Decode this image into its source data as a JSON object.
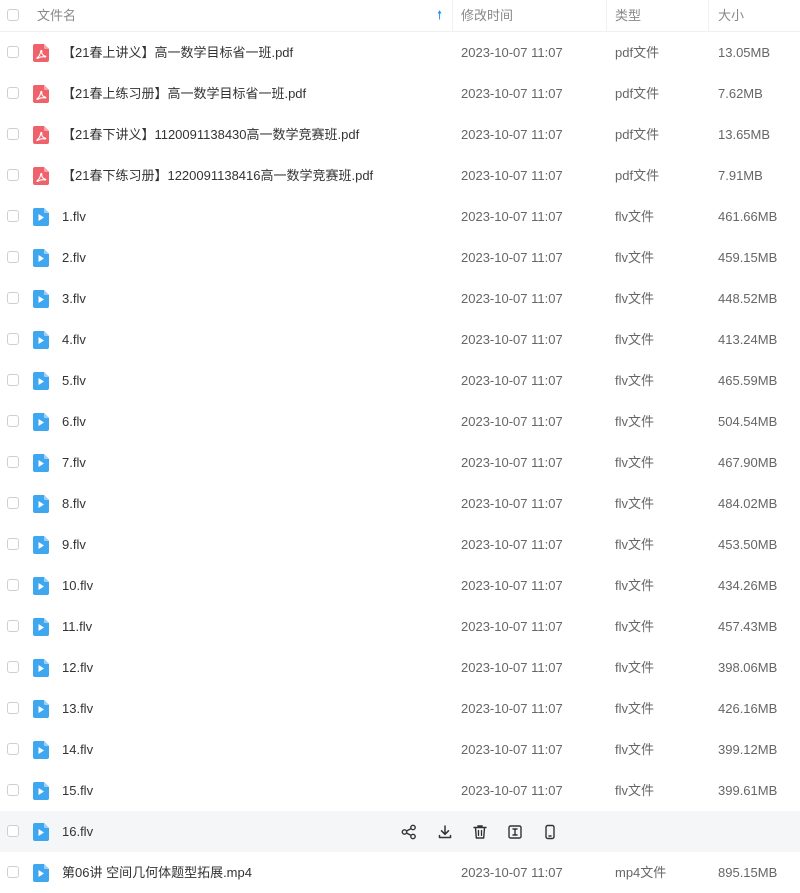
{
  "header": {
    "name_label": "文件名",
    "mtime_label": "修改时间",
    "type_label": "类型",
    "size_label": "大小",
    "sort_icon": "sort-ascending-arrow-icon"
  },
  "colors": {
    "accent": "#1e90ff",
    "pdf_icon": "#f0626b",
    "video_icon": "#3fa6f0",
    "hover_row": "#f5f6f8"
  },
  "files": [
    {
      "name": "【21春上讲义】高一数学目标省一班.pdf",
      "mtime": "2023-10-07 11:07",
      "type": "pdf文件",
      "size": "13.05MB",
      "icon": "pdf-file-icon"
    },
    {
      "name": "【21春上练习册】高一数学目标省一班.pdf",
      "mtime": "2023-10-07 11:07",
      "type": "pdf文件",
      "size": "7.62MB",
      "icon": "pdf-file-icon"
    },
    {
      "name": "【21春下讲义】1120091138430高一数学竞赛班.pdf",
      "mtime": "2023-10-07 11:07",
      "type": "pdf文件",
      "size": "13.65MB",
      "icon": "pdf-file-icon"
    },
    {
      "name": "【21春下练习册】1220091138416高一数学竞赛班.pdf",
      "mtime": "2023-10-07 11:07",
      "type": "pdf文件",
      "size": "7.91MB",
      "icon": "pdf-file-icon"
    },
    {
      "name": "1.flv",
      "mtime": "2023-10-07 11:07",
      "type": "flv文件",
      "size": "461.66MB",
      "icon": "video-file-icon"
    },
    {
      "name": "2.flv",
      "mtime": "2023-10-07 11:07",
      "type": "flv文件",
      "size": "459.15MB",
      "icon": "video-file-icon"
    },
    {
      "name": "3.flv",
      "mtime": "2023-10-07 11:07",
      "type": "flv文件",
      "size": "448.52MB",
      "icon": "video-file-icon"
    },
    {
      "name": "4.flv",
      "mtime": "2023-10-07 11:07",
      "type": "flv文件",
      "size": "413.24MB",
      "icon": "video-file-icon"
    },
    {
      "name": "5.flv",
      "mtime": "2023-10-07 11:07",
      "type": "flv文件",
      "size": "465.59MB",
      "icon": "video-file-icon"
    },
    {
      "name": "6.flv",
      "mtime": "2023-10-07 11:07",
      "type": "flv文件",
      "size": "504.54MB",
      "icon": "video-file-icon"
    },
    {
      "name": "7.flv",
      "mtime": "2023-10-07 11:07",
      "type": "flv文件",
      "size": "467.90MB",
      "icon": "video-file-icon"
    },
    {
      "name": "8.flv",
      "mtime": "2023-10-07 11:07",
      "type": "flv文件",
      "size": "484.02MB",
      "icon": "video-file-icon"
    },
    {
      "name": "9.flv",
      "mtime": "2023-10-07 11:07",
      "type": "flv文件",
      "size": "453.50MB",
      "icon": "video-file-icon"
    },
    {
      "name": "10.flv",
      "mtime": "2023-10-07 11:07",
      "type": "flv文件",
      "size": "434.26MB",
      "icon": "video-file-icon"
    },
    {
      "name": "11.flv",
      "mtime": "2023-10-07 11:07",
      "type": "flv文件",
      "size": "457.43MB",
      "icon": "video-file-icon"
    },
    {
      "name": "12.flv",
      "mtime": "2023-10-07 11:07",
      "type": "flv文件",
      "size": "398.06MB",
      "icon": "video-file-icon"
    },
    {
      "name": "13.flv",
      "mtime": "2023-10-07 11:07",
      "type": "flv文件",
      "size": "426.16MB",
      "icon": "video-file-icon"
    },
    {
      "name": "14.flv",
      "mtime": "2023-10-07 11:07",
      "type": "flv文件",
      "size": "399.12MB",
      "icon": "video-file-icon"
    },
    {
      "name": "15.flv",
      "mtime": "2023-10-07 11:07",
      "type": "flv文件",
      "size": "399.61MB",
      "icon": "video-file-icon"
    },
    {
      "name": "16.flv",
      "mtime": "",
      "type": "",
      "size": "",
      "icon": "video-file-icon",
      "hovered": true
    },
    {
      "name": "第06讲 空间几何体题型拓展.mp4",
      "mtime": "2023-10-07 11:07",
      "type": "mp4文件",
      "size": "895.15MB",
      "icon": "video-file-icon"
    }
  ],
  "row_actions": [
    {
      "name": "share-icon"
    },
    {
      "name": "download-icon"
    },
    {
      "name": "delete-icon"
    },
    {
      "name": "rename-icon"
    },
    {
      "name": "mobile-icon"
    }
  ]
}
